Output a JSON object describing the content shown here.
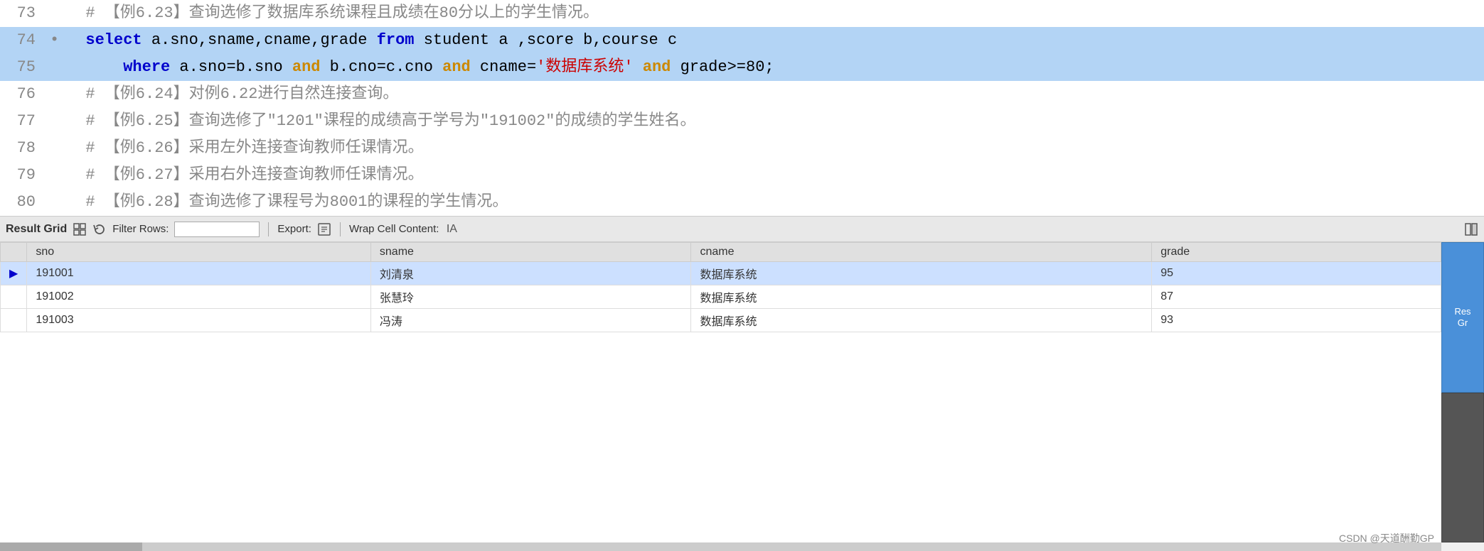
{
  "editor": {
    "lines": [
      {
        "number": "73",
        "bullet": "",
        "selected": false,
        "parts": [
          {
            "type": "comment",
            "text": "  # 【例6.23】查询选修了数据库系统课程且成绩在80分以上的学生情况。"
          }
        ]
      },
      {
        "number": "74",
        "bullet": "•",
        "selected": true,
        "parts": [
          {
            "type": "kw-select",
            "text": "  select"
          },
          {
            "type": "sql-normal",
            "text": " a.sno,sname,cname,grade "
          },
          {
            "type": "kw-from",
            "text": "from"
          },
          {
            "type": "sql-normal",
            "text": " student a ,score b,course c"
          }
        ]
      },
      {
        "number": "75",
        "bullet": "",
        "selected": true,
        "parts": [
          {
            "type": "sql-normal",
            "text": "      "
          },
          {
            "type": "kw-where",
            "text": "where"
          },
          {
            "type": "sql-normal",
            "text": " a.sno=b.sno "
          },
          {
            "type": "kw-and",
            "text": "and"
          },
          {
            "type": "sql-normal",
            "text": " b.cno=c.cno "
          },
          {
            "type": "kw-and",
            "text": "and"
          },
          {
            "type": "sql-normal",
            "text": " cname="
          },
          {
            "type": "sql-string",
            "text": "'数据库系统'"
          },
          {
            "type": "sql-normal",
            "text": " "
          },
          {
            "type": "kw-and",
            "text": "and"
          },
          {
            "type": "sql-normal",
            "text": " grade>=80;"
          }
        ]
      },
      {
        "number": "76",
        "bullet": "",
        "selected": false,
        "parts": [
          {
            "type": "comment",
            "text": "  # 【例6.24】对例6.22进行自然连接查询。"
          }
        ]
      },
      {
        "number": "77",
        "bullet": "",
        "selected": false,
        "parts": [
          {
            "type": "comment",
            "text": "  # 【例6.25】查询选修了\"1201\"课程的成绩高于学号为\"191002\"的成绩的学生姓名。"
          }
        ]
      },
      {
        "number": "78",
        "bullet": "",
        "selected": false,
        "parts": [
          {
            "type": "comment",
            "text": "  # 【例6.26】采用左外连接查询教师任课情况。"
          }
        ]
      },
      {
        "number": "79",
        "bullet": "",
        "selected": false,
        "parts": [
          {
            "type": "comment",
            "text": "  # 【例6.27】采用右外连接查询教师任课情况。"
          }
        ]
      },
      {
        "number": "80",
        "bullet": "",
        "selected": false,
        "parts": [
          {
            "type": "comment",
            "text": "  # 【例6.28】查询选修了课程号为8001的课程的学生情况。"
          }
        ]
      }
    ]
  },
  "toolbar": {
    "result_grid_label": "Result Grid",
    "filter_rows_label": "Filter Rows:",
    "filter_placeholder": "",
    "export_label": "Export:",
    "wrap_cell_label": "Wrap Cell Content:",
    "wrap_icon": "IA"
  },
  "table": {
    "columns": [
      "sno",
      "sname",
      "cname",
      "grade"
    ],
    "rows": [
      {
        "arrow": "▶",
        "sno": "191001",
        "sname": "刘清泉",
        "cname": "数据库系统",
        "grade": "95",
        "selected": true
      },
      {
        "arrow": "",
        "sno": "191002",
        "sname": "张慧玲",
        "cname": "数据库系统",
        "grade": "87",
        "selected": false
      },
      {
        "arrow": "",
        "sno": "191003",
        "sname": "冯涛",
        "cname": "数据库系统",
        "grade": "93",
        "selected": false
      }
    ]
  },
  "right_buttons": [
    {
      "label": "Res\nGr"
    },
    {
      "label": ""
    }
  ],
  "csdn_watermark": "CSDN @天道酬勤GP"
}
